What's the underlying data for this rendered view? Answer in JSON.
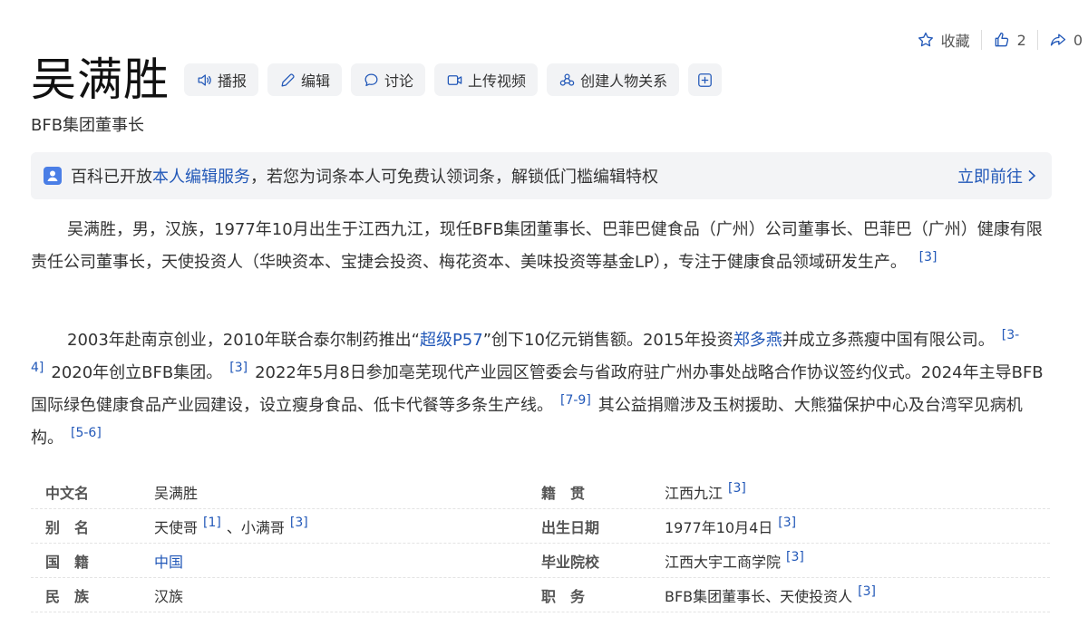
{
  "top_actions": {
    "favorite_label": "收藏",
    "like_count": "2",
    "share_count": "0"
  },
  "title": "吴满胜",
  "toolbar": {
    "broadcast": "播报",
    "edit": "编辑",
    "discuss": "讨论",
    "upload_video": "上传视频",
    "create_relation": "创建人物关系"
  },
  "subtitle": "BFB集团董事长",
  "notice": {
    "text_before": "百科已开放",
    "link": "本人编辑服务",
    "text_after": "，若您为词条本人可免费认领词条，解锁低门槛编辑特权",
    "go": "立即前往"
  },
  "para1": {
    "text": "吴满胜，男，汉族，1977年10月出生于江西九江，现任BFB集团董事长、巴菲巴健食品（广州）公司董事长、巴菲巴（广州）健康有限责任公司董事长，天使投资人（华映资本、宝捷会投资、梅花资本、美味投资等基金LP），专注于健康食品领域研发生产。",
    "ref": "[3]"
  },
  "para2": {
    "t1": "2003年赴南京创业，2010年联合泰尔制药推出“",
    "link1": "超级P57",
    "t2": "”创下10亿元销售额。2015年投资",
    "link2": "郑多燕",
    "t3": "并成立多燕瘦中国有限公司。",
    "ref1": "[3-4]",
    "t4": "2020年创立BFB集团。",
    "ref2": "[3]",
    "t5": "2022年5月8日参加亳芜现代产业园区管委会与省政府驻广州办事处战略合作协议签约仪式。2024年主导BFB国际绿色健康食品产业园建设，设立瘦身食品、低卡代餐等多条生产线。",
    "ref3": "[7-9]",
    "t6": "其公益捐赠涉及玉树援助、大熊猫保护中心及台湾罕见病机构。",
    "ref4": "[5-6]"
  },
  "info": {
    "r1": {
      "l1": "中文名",
      "v1": "吴满胜",
      "l2": "籍　贯",
      "v2": "江西九江",
      "ref2": "[3]"
    },
    "r2": {
      "l1": "别　名",
      "v1a": "天使哥",
      "ref1a": "[1]",
      "v1b": "、小满哥",
      "ref1b": "[3]",
      "l2": "出生日期",
      "v2": "1977年10月4日",
      "ref2": "[3]"
    },
    "r3": {
      "l1": "国　籍",
      "v1": "中国",
      "l2": "毕业院校",
      "v2": "江西大宇工商学院",
      "ref2": "[3]"
    },
    "r4": {
      "l1": "民　族",
      "v1": "汉族",
      "l2": "职　务",
      "v2": "BFB集团董事长、天使投资人",
      "ref2": "[3]"
    }
  },
  "colors": {
    "link": "#2258b8",
    "button_bg": "#f2f3f5",
    "notice_bg": "#f3f4f6"
  }
}
